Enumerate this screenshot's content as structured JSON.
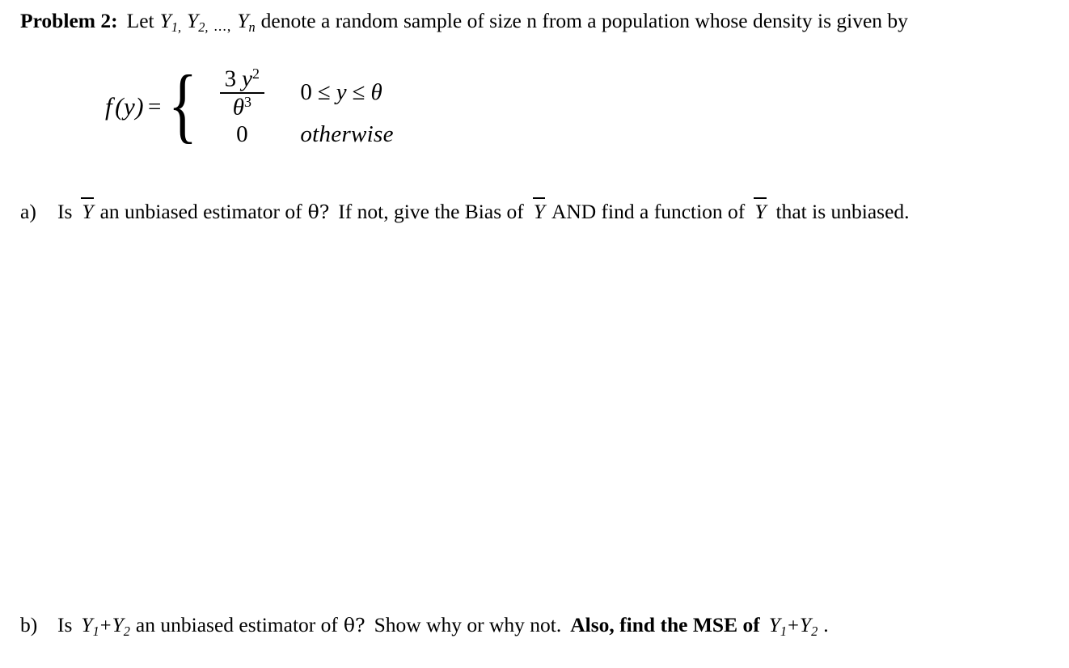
{
  "document": {
    "type": "math-homework-problem",
    "background_color": "#ffffff",
    "text_color": "#000000"
  },
  "problem": {
    "label": "Problem 2:",
    "intro_before_vars": "Let",
    "var_y": "Y",
    "sub_1": "1,",
    "sub_2": "2,",
    "ellipsis": "...,",
    "sub_n": "n",
    "intro_after_vars": "denote a random sample of size n from a population whose density is given by"
  },
  "formula": {
    "function_name": "f",
    "function_arg": "(y)",
    "equals": "=",
    "brace": "{",
    "case1": {
      "numerator_coefficient": "3",
      "numerator_var": "y",
      "numerator_exponent": "2",
      "denominator_var": "θ",
      "denominator_exponent": "3",
      "condition": "0 ≤ y ≤ θ",
      "condition_parts": {
        "lower": "0",
        "le1": "≤",
        "variable": "y",
        "le2": "≤",
        "upper": "θ"
      }
    },
    "case2": {
      "value": "0",
      "condition": "otherwise"
    }
  },
  "parts": [
    {
      "marker": "a)",
      "segments": [
        {
          "text": "Is",
          "style": "normal"
        },
        {
          "text": "Y",
          "style": "ybar"
        },
        {
          "text": "an unbiased estimator of",
          "style": "normal"
        },
        {
          "text": "θ?",
          "style": "theta-upright"
        },
        {
          "text": "If not, give the Bias of",
          "style": "normal"
        },
        {
          "text": "Y",
          "style": "ybar"
        },
        {
          "text": "AND find a function of",
          "style": "normal"
        },
        {
          "text": "Y",
          "style": "ybar"
        },
        {
          "text": "that is unbiased.",
          "style": "normal"
        }
      ],
      "plain_text": "a)  Is Ȳ an unbiased estimator of θ?  If not, give the Bias of Ȳ AND find a function of Ȳ that is unbiased."
    },
    {
      "marker": "b)",
      "segments": [
        {
          "text": "Is",
          "style": "normal"
        },
        {
          "text": "Y1 + Y2",
          "style": "y-sum"
        },
        {
          "text": "an unbiased estimator of",
          "style": "normal"
        },
        {
          "text": "θ?",
          "style": "theta-upright"
        },
        {
          "text": "Show why or why not.",
          "style": "normal"
        },
        {
          "text": "Also, find the MSE of",
          "style": "bold"
        },
        {
          "text": "Y1 + Y2 .",
          "style": "y-sum"
        }
      ],
      "plain_text": "b)  Is Y₁ + Y₂ an unbiased estimator of θ?  Show why or why not.  Also, find the MSE of Y₁ + Y₂ ."
    }
  ],
  "part_a": {
    "marker": "a)",
    "t1": "Is",
    "y1": "Y",
    "t2": "an unbiased estimator of",
    "theta": "θ?",
    "t3": "If not, give the Bias of",
    "y2": "Y",
    "t4": "AND find a function of",
    "y3": "Y",
    "t5": "that is unbiased."
  },
  "part_b": {
    "marker": "b)",
    "t1": "Is",
    "y_a": "Y",
    "sub_a": "1",
    "plus": "+",
    "y_b": "Y",
    "sub_b": "2",
    "t2": "an unbiased estimator of",
    "theta": "θ?",
    "t3": "Show why or why not.",
    "bold_text": "Also, find the MSE of",
    "y_c": "Y",
    "sub_c": "1",
    "plus2": "+",
    "y_d": "Y",
    "sub_d": "2",
    "period": "."
  }
}
